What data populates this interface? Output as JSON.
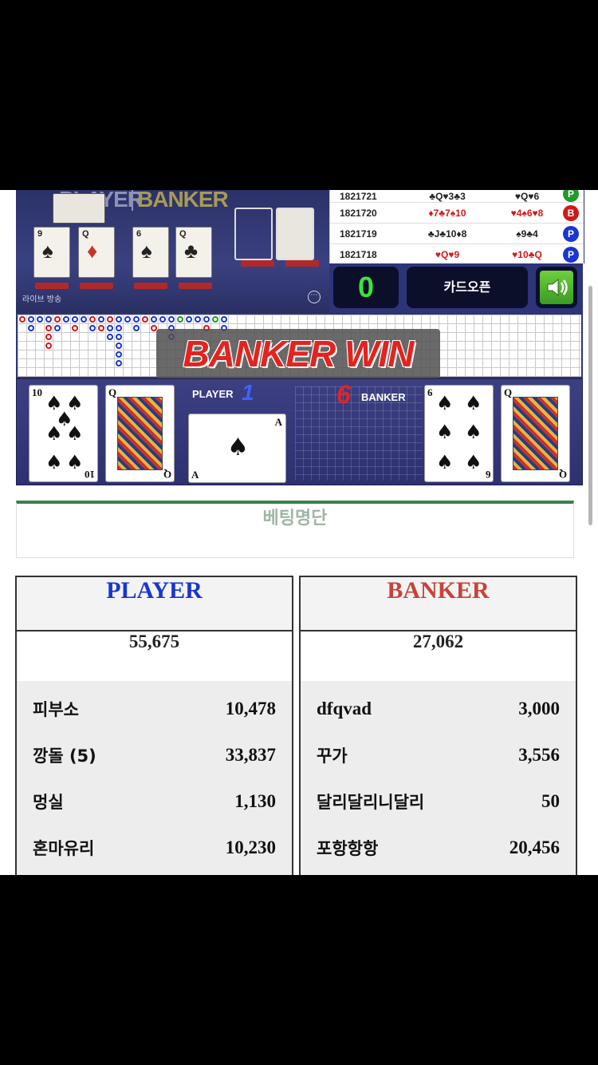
{
  "table_view": {
    "player_label": "PLAYER",
    "banker_label": "BANKER",
    "live_label": "라이브 방송",
    "mini_cards": [
      {
        "rank": "9",
        "suit": "♠"
      },
      {
        "rank": "Q",
        "suit": "♦"
      },
      {
        "rank": "6",
        "suit": "♠"
      },
      {
        "rank": "Q",
        "suit": "♣"
      }
    ]
  },
  "history": {
    "rows": [
      {
        "id": "1821721",
        "player": "♣Q♥3♣3",
        "banker": "♥Q♥6",
        "result": "P",
        "result_color": "#1f9a2b"
      },
      {
        "id": "1821720",
        "player": "♦7♣7♠10",
        "banker": "♥4♠6♥8",
        "result": "B",
        "result_color": "#d01a1a"
      },
      {
        "id": "1821719",
        "player": "♣J♣10♦8",
        "banker": "♠9♣4",
        "result": "P",
        "result_color": "#1a35d0"
      },
      {
        "id": "1821718",
        "player": "♥Q♥9",
        "banker": "♥10♣Q",
        "result": "P",
        "result_color": "#1a35d0"
      }
    ]
  },
  "controls": {
    "count": "0",
    "card_open_label": "카드오픈"
  },
  "result": {
    "banner": "BANKER WIN",
    "player_label": "PLAYER",
    "player_score": "1",
    "banker_score": "6",
    "banker_label": "BANKER",
    "player_cards": [
      {
        "rank": "10",
        "suit": "♠"
      },
      {
        "rank": "Q",
        "suit": "♠"
      },
      {
        "rank": "A",
        "suit": "♠"
      }
    ],
    "banker_cards": [
      {
        "rank": "6",
        "suit": "♠"
      },
      {
        "rank": "Q",
        "suit": "♣"
      }
    ]
  },
  "betting": {
    "title": "베팅명단",
    "player": {
      "header": "PLAYER",
      "header_color": "#1a35d0",
      "total": "55,675",
      "rows": [
        {
          "name": "피부소",
          "amount": "10,478"
        },
        {
          "name": "깡돌 (5)",
          "amount": "33,837"
        },
        {
          "name": "멍실",
          "amount": "1,130"
        },
        {
          "name": "혼마유리",
          "amount": "10,230"
        }
      ]
    },
    "banker": {
      "header": "BANKER",
      "header_color": "#c8423a",
      "total": "27,062",
      "rows": [
        {
          "name": "dfqvad",
          "amount": "3,000"
        },
        {
          "name": "꾸가",
          "amount": "3,556"
        },
        {
          "name": "달리달리니달리",
          "amount": "50"
        },
        {
          "name": "포항항항",
          "amount": "20,456"
        }
      ]
    }
  }
}
